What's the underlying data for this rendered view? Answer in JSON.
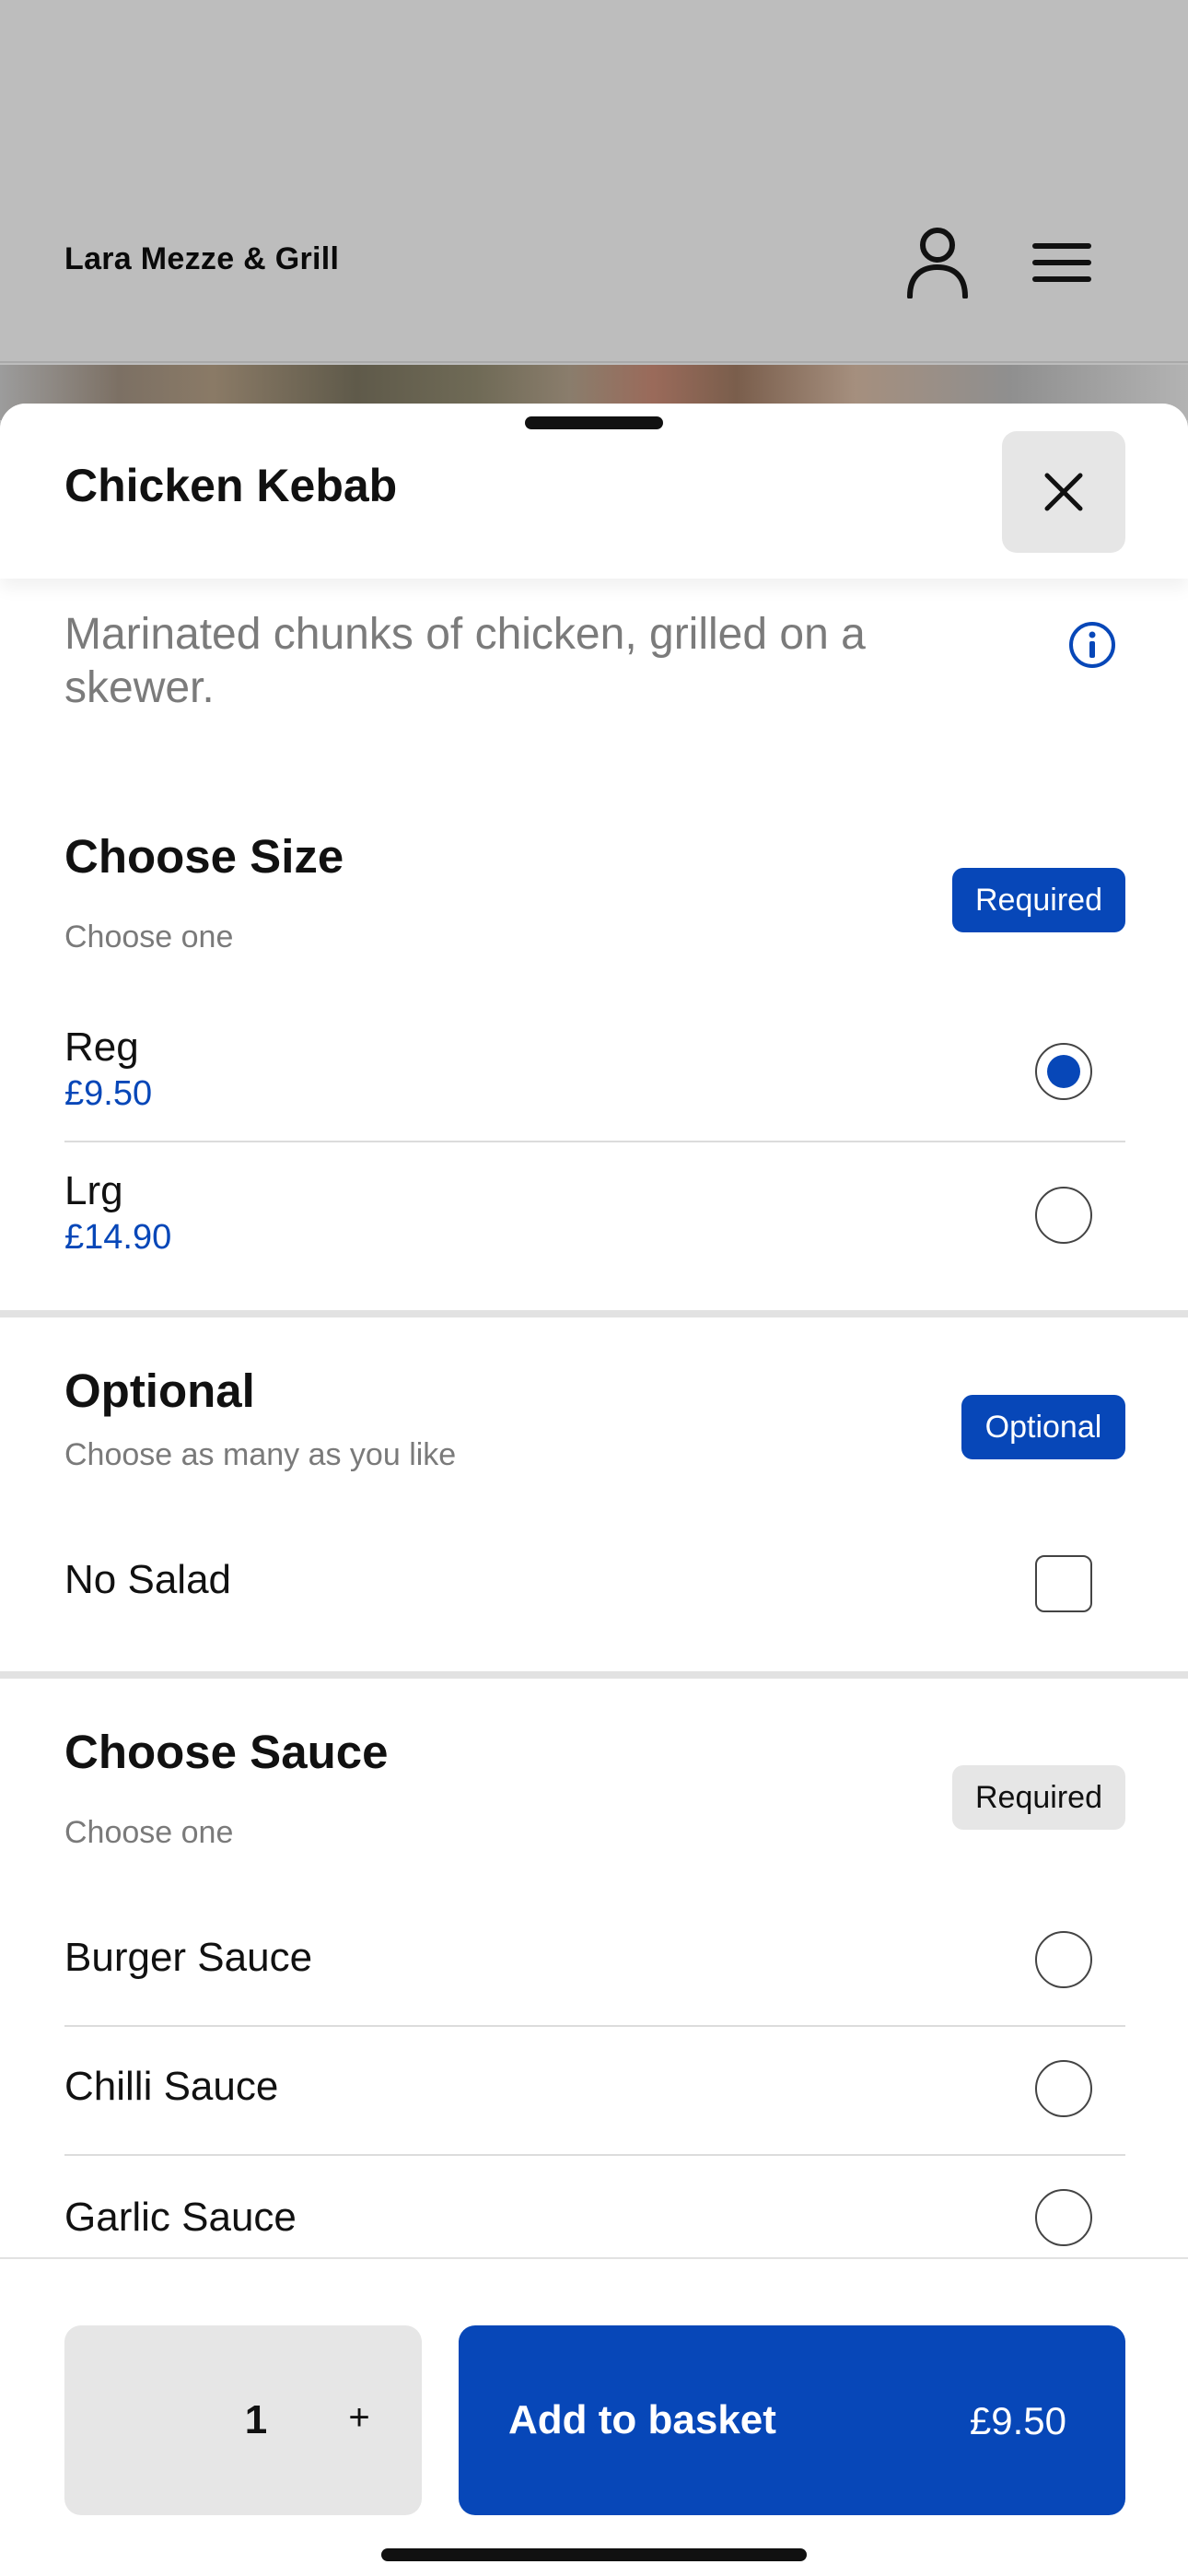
{
  "header": {
    "restaurant_name": "Lara Mezze & Grill",
    "icons": [
      "user-icon",
      "menu-icon"
    ]
  },
  "item": {
    "title": "Chicken Kebab",
    "description": "Marinated chunks of chicken, grilled on a skewer."
  },
  "sections": {
    "size": {
      "title": "Choose Size",
      "subtitle": "Choose one",
      "badge": "Required",
      "options": [
        {
          "name": "Reg",
          "price": "£9.50",
          "selected": true
        },
        {
          "name": "Lrg",
          "price": "£14.90",
          "selected": false
        }
      ]
    },
    "optional": {
      "title": "Optional",
      "subtitle": "Choose as many as you like",
      "badge": "Optional",
      "options": [
        {
          "name": "No Salad",
          "checked": false
        }
      ]
    },
    "sauce": {
      "title": "Choose Sauce",
      "subtitle": "Choose one",
      "badge": "Required",
      "options": [
        {
          "name": "Burger Sauce",
          "selected": false
        },
        {
          "name": "Chilli Sauce",
          "selected": false
        },
        {
          "name": "Garlic Sauce",
          "selected": false
        }
      ]
    }
  },
  "footer": {
    "quantity": "1",
    "plus": "+",
    "add_label": "Add to basket",
    "add_price": "£9.50"
  },
  "colors": {
    "accent": "#0747b8",
    "overlay": "#bdbdbd",
    "badge_grey": "#e6e6e6"
  }
}
